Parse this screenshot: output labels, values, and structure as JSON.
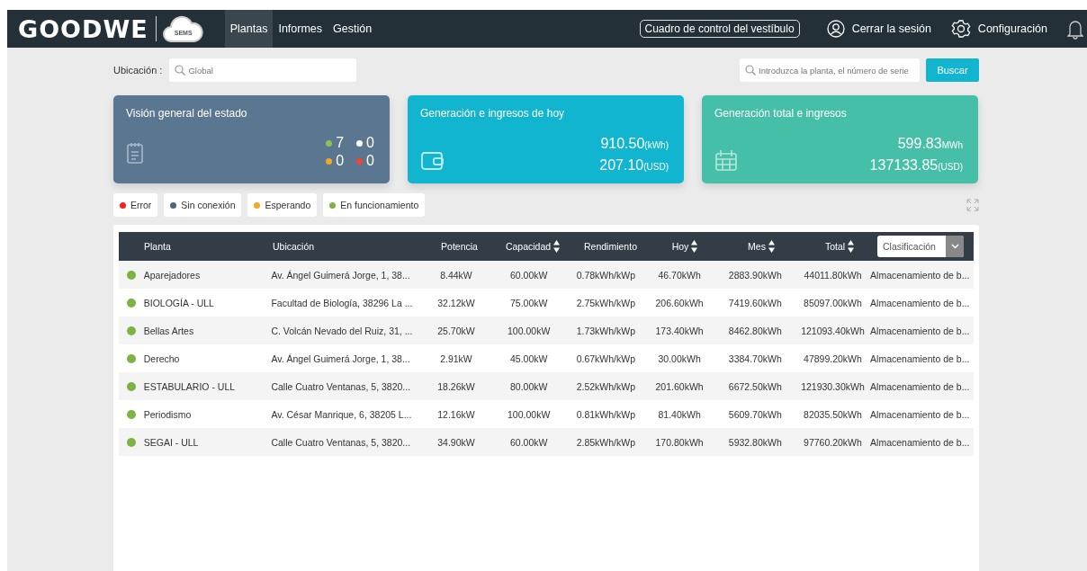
{
  "header": {
    "logo": "GOODWE",
    "logo_badge": "SEMS",
    "nav": [
      {
        "label": "Plantas",
        "selected": true
      },
      {
        "label": "Informes",
        "selected": false
      },
      {
        "label": "Gestión",
        "selected": false
      }
    ],
    "lobby_button": "Cuadro de control del vestíbulo",
    "logout": "Cerrar la sesión",
    "settings": "Configuración"
  },
  "filters": {
    "location_label": "Ubicación :",
    "location_placeholder": "Global",
    "search_placeholder": "Introduzca la planta, el número de serie",
    "search_button": "Buscar"
  },
  "cards": [
    {
      "kind": "status",
      "title": "Visión general del estado",
      "counts": [
        {
          "value": "7",
          "color": "#8bc34a"
        },
        {
          "value": "0",
          "color": "#ffffff"
        },
        {
          "value": "0",
          "color": "#f5a623"
        },
        {
          "value": "0",
          "color": "#f44336"
        }
      ]
    },
    {
      "kind": "today",
      "title": "Generación e ingresos de hoy",
      "lines": [
        {
          "value": "910.50",
          "unit": "(kWh)"
        },
        {
          "value": "207.10",
          "unit": "(USD)"
        }
      ]
    },
    {
      "kind": "total",
      "title": "Generación total e ingresos",
      "lines": [
        {
          "value": "599.83",
          "unit": "MWh"
        },
        {
          "value": "137133.85",
          "unit": "(USD)"
        }
      ]
    }
  ],
  "legend": [
    {
      "label": "Error",
      "color": "#f5221b"
    },
    {
      "label": "Sin conexión",
      "color": "#4d6580"
    },
    {
      "label": "Esperando",
      "color": "#f5a623"
    },
    {
      "label": "En funcionamiento",
      "color": "#7cb342"
    }
  ],
  "table": {
    "columns": [
      {
        "label": "Planta",
        "sortable": false
      },
      {
        "label": "Ubicación",
        "sortable": false
      },
      {
        "label": "Potencia",
        "sortable": false
      },
      {
        "label": "Capacidad",
        "sortable": true
      },
      {
        "label": "Rendimiento",
        "sortable": false
      },
      {
        "label": "Hoy",
        "sortable": true
      },
      {
        "label": "Mes",
        "sortable": true
      },
      {
        "label": "Total",
        "sortable": true
      }
    ],
    "classification_select": "Clasificación",
    "rows": [
      {
        "color": "#7cb342",
        "cells": [
          "Aparejadores",
          "Av. Ángel Guimerá Jorge, 1, 38...",
          "8.44kW",
          "60.00kW",
          "0.78kWh/kWp",
          "46.70kWh",
          "2883.90kWh",
          "44011.80kWh",
          "Almacenamiento de b..."
        ]
      },
      {
        "color": "#7cb342",
        "cells": [
          "BIOLOGÍA - ULL",
          "Facultad de Biología, 38296 La ...",
          "32.12kW",
          "75.00kW",
          "2.75kWh/kWp",
          "206.60kWh",
          "7419.60kWh",
          "85097.00kWh",
          "Almacenamiento de b..."
        ]
      },
      {
        "color": "#7cb342",
        "cells": [
          "Bellas Artes",
          "C. Volcán Nevado del Ruiz, 31, ...",
          "25.70kW",
          "100.00kW",
          "1.73kWh/kWp",
          "173.40kWh",
          "8462.80kWh",
          "121093.40kWh",
          "Almacenamiento de b..."
        ]
      },
      {
        "color": "#7cb342",
        "cells": [
          "Derecho",
          "Av. Ángel Guimerá Jorge, 1, 38...",
          "2.91kW",
          "45.00kW",
          "0.67kWh/kWp",
          "30.00kWh",
          "3384.70kWh",
          "47899.20kWh",
          "Almacenamiento de b..."
        ]
      },
      {
        "color": "#7cb342",
        "cells": [
          "ESTABULARIO - ULL",
          "Calle Cuatro Ventanas, 5, 3820...",
          "18.26kW",
          "80.00kW",
          "2.52kWh/kWp",
          "201.60kWh",
          "6672.50kWh",
          "121930.30kWh",
          "Almacenamiento de b..."
        ]
      },
      {
        "color": "#7cb342",
        "cells": [
          "Periodismo",
          "Av. César Manrique, 6, 38205 L...",
          "12.16kW",
          "100.00kW",
          "0.81kWh/kWp",
          "81.40kWh",
          "5609.70kWh",
          "82035.50kWh",
          "Almacenamiento de b..."
        ]
      },
      {
        "color": "#7cb342",
        "cells": [
          "SEGAI - ULL",
          "Calle Cuatro Ventanas, 5, 3820...",
          "34.90kW",
          "60.00kW",
          "2.85kWh/kWp",
          "170.80kWh",
          "5932.80kWh",
          "97760.20kWh",
          "Almacenamiento de b..."
        ]
      }
    ]
  }
}
